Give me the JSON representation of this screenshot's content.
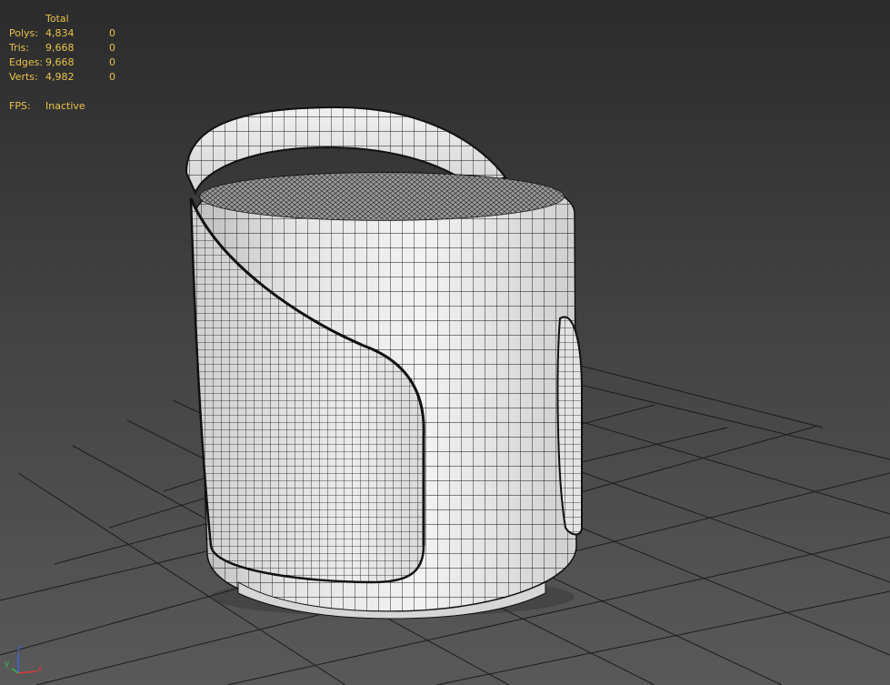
{
  "viewport": {
    "stats": {
      "header": "Total",
      "rows": [
        {
          "label": "Polys:",
          "total": "4,834",
          "selected": "0"
        },
        {
          "label": "Tris:",
          "total": "9,668",
          "selected": "0"
        },
        {
          "label": "Edges:",
          "total": "9,668",
          "selected": "0"
        },
        {
          "label": "Verts:",
          "total": "4,982",
          "selected": "0"
        }
      ],
      "fps_label": "FPS:",
      "fps_value": "Inactive",
      "text_color": "#e7c34b"
    },
    "gizmo": {
      "axes": {
        "x": "x",
        "y": "y",
        "z": "z"
      },
      "colors": {
        "x": "#d43b3b",
        "y": "#3fb44a",
        "z": "#3b66d8"
      }
    },
    "grid_color": "#1c1c1c",
    "mesh": {
      "surface": "#e9e9e9",
      "shade": "#c4c4c4",
      "wire": "#111111"
    }
  }
}
